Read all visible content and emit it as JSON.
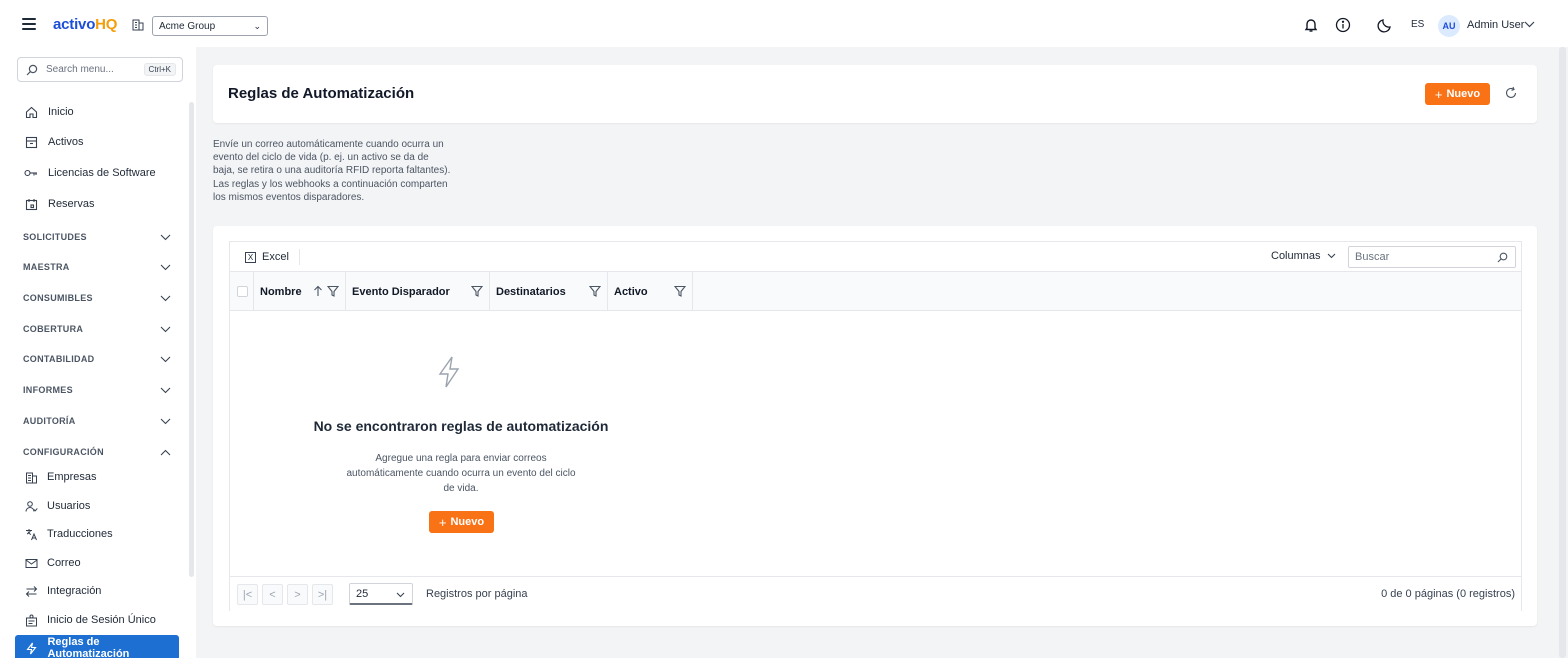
{
  "topbar": {
    "logo_main": "activo",
    "logo_accent": "HQ",
    "company": "Acme Group",
    "language": "ES",
    "avatar_initials": "AU",
    "user_name": "Admin User"
  },
  "sidebar": {
    "search_placeholder": "Search menu...",
    "search_shortcut": "Ctrl+K",
    "items": [
      {
        "label": "Inicio",
        "icon": "home-icon"
      },
      {
        "label": "Activos",
        "icon": "archive-icon"
      },
      {
        "label": "Licencias de Software",
        "icon": "key-icon"
      },
      {
        "label": "Reservas",
        "icon": "calendar-icon"
      }
    ],
    "sections": [
      "SOLICITUDES",
      "MAESTRA",
      "CONSUMIBLES",
      "COBERTURA",
      "CONTABILIDAD",
      "INFORMES",
      "AUDITORÍA",
      "CONFIGURACIÓN"
    ],
    "config_items": [
      {
        "label": "Empresas",
        "icon": "building-icon"
      },
      {
        "label": "Usuarios",
        "icon": "users-icon"
      },
      {
        "label": "Traducciones",
        "icon": "translate-icon"
      },
      {
        "label": "Correo",
        "icon": "mail-icon"
      },
      {
        "label": "Integración",
        "icon": "arrows-icon"
      },
      {
        "label": "Inicio de Sesión Único",
        "icon": "sso-icon"
      },
      {
        "label": "Reglas de Automatización",
        "icon": "bolt-icon"
      }
    ]
  },
  "main": {
    "title": "Reglas de Automatización",
    "new_label": "Nuevo",
    "description": "Envíe un correo automáticamente cuando ocurra un evento del ciclo de vida (p. ej. un activo se da de baja, se retira o una auditoría RFID reporta faltantes). Las reglas y los webhooks a continuación comparten los mismos eventos disparadores."
  },
  "grid": {
    "excel_label": "Excel",
    "columns_label": "Columnas",
    "search_placeholder": "Buscar",
    "columns": [
      "Nombre",
      "Evento Disparador",
      "Destinatarios",
      "Activo"
    ],
    "empty_title": "No se encontraron reglas de automatización",
    "empty_subtitle": "Agregue una regla para enviar correos automáticamente cuando ocurra un evento del ciclo de vida.",
    "empty_new_label": "Nuevo",
    "page_size": "25",
    "per_page_label": "Registros por página",
    "page_info": "0 de 0 páginas (0 registros)"
  },
  "colors": {
    "primary": "#1d6fd1",
    "accent": "#f97316",
    "logo_accent": "#f59e0b"
  }
}
